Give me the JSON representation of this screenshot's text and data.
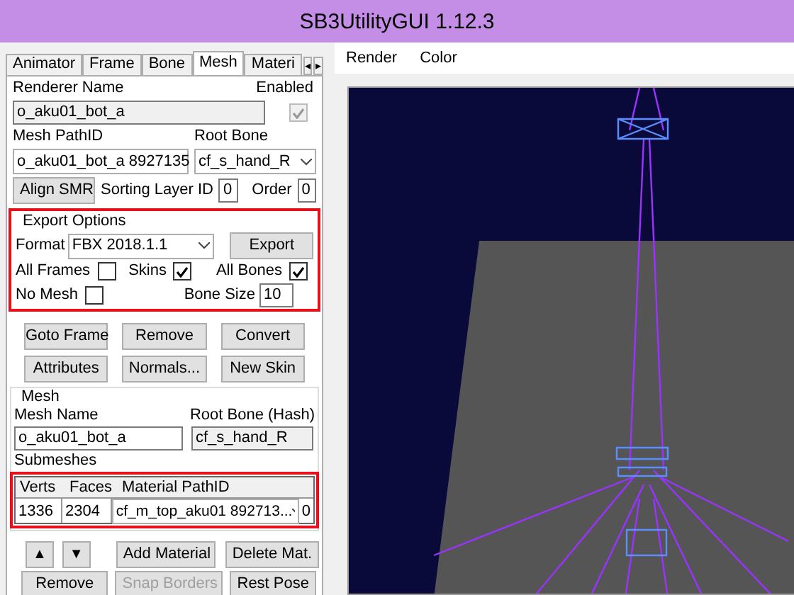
{
  "window": {
    "title": "SB3UtilityGUI 1.12.3"
  },
  "tabs": [
    {
      "label": "Animator",
      "selected": false
    },
    {
      "label": "Frame",
      "selected": false
    },
    {
      "label": "Bone",
      "selected": false
    },
    {
      "label": "Mesh",
      "selected": true
    },
    {
      "label": "Materi",
      "selected": false
    }
  ],
  "tab_scroll": [
    "◂",
    "▸"
  ],
  "renderer": {
    "name_label": "Renderer Name",
    "name_value": "o_aku01_bot_a",
    "enabled_label": "Enabled",
    "enabled": true,
    "enabled_disabled": true,
    "mesh_pathid_label": "Mesh PathID",
    "mesh_pathid_value": "o_aku01_bot_a 8927135",
    "root_bone_label": "Root Bone",
    "root_bone_value": "cf_s_hand_R",
    "align_button": "Align SMR",
    "sorting_label": "Sorting Layer ID",
    "sorting_value": "0",
    "order_label": "Order",
    "order_value": "0"
  },
  "export_options": {
    "title": "Export Options",
    "format_label": "Format",
    "format_value": "FBX 2018.1.1",
    "export_button": "Export",
    "checks": [
      {
        "label": "All Frames",
        "checked": false
      },
      {
        "label": "Skins",
        "checked": true
      },
      {
        "label": "All Bones",
        "checked": true
      },
      {
        "label": "No Mesh",
        "checked": false
      }
    ],
    "bone_size_label": "Bone Size",
    "bone_size_value": "10"
  },
  "action_buttons": [
    {
      "label": "Goto Frame",
      "disabled": false
    },
    {
      "label": "Remove",
      "disabled": false
    },
    {
      "label": "Convert",
      "disabled": false
    },
    {
      "label": "Attributes",
      "disabled": false
    },
    {
      "label": "Normals...",
      "disabled": false
    },
    {
      "label": "New Skin",
      "disabled": false
    }
  ],
  "mesh": {
    "title": "Mesh",
    "name_label": "Mesh Name",
    "name_value": "o_aku01_bot_a",
    "root_bone_label": "Root Bone (Hash)",
    "root_bone_value": "cf_s_hand_R",
    "submeshes_label": "Submeshes",
    "table": {
      "columns": [
        "Verts",
        "Faces",
        "Material PathID"
      ],
      "rows": [
        {
          "cells": [
            "1336",
            "2304",
            "cf_m_top_aku01 892713..."
          ],
          "column_4": "0"
        }
      ]
    }
  },
  "arrow_buttons": [
    "▲",
    "▼"
  ],
  "material_buttons": [
    {
      "label": "Add Material",
      "disabled": false
    },
    {
      "label": "Delete Mat.",
      "disabled": false
    }
  ],
  "bottom_buttons": [
    {
      "label": "Remove",
      "disabled": false
    },
    {
      "label": "Snap Borders",
      "disabled": true
    },
    {
      "label": "Rest Pose",
      "disabled": false
    }
  ],
  "viewport": {
    "menu": [
      "Render",
      "Color"
    ]
  }
}
